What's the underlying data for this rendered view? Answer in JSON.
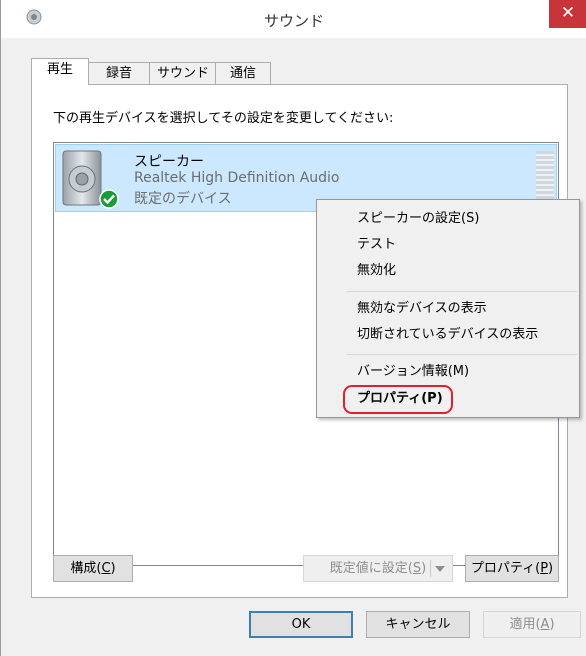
{
  "window": {
    "title": "サウンド",
    "close_glyph": "✕"
  },
  "tabs": [
    {
      "label": "再生",
      "active": true
    },
    {
      "label": "録音",
      "active": false
    },
    {
      "label": "サウンド",
      "active": false
    },
    {
      "label": "通信",
      "active": false
    }
  ],
  "instruction": "下の再生デバイスを選択してその設定を変更してください:",
  "devices": [
    {
      "name": "スピーカー",
      "driver": "Realtek High Definition Audio",
      "status": "既定のデバイス",
      "icon": "speaker-icon",
      "status_icon": "check-icon"
    }
  ],
  "context_menu": {
    "items": [
      {
        "label": "スピーカーの設定(S)"
      },
      {
        "label": "テスト"
      },
      {
        "label": "無効化"
      },
      {
        "label": "無効なデバイスの表示"
      },
      {
        "label": "切断されているデバイスの表示"
      },
      {
        "label": "バージョン情報(M)"
      },
      {
        "label": "プロパティ(P)",
        "highlighted": true
      }
    ]
  },
  "panel_buttons": {
    "configure": {
      "label": "構成(",
      "key": "C",
      "tail": ")"
    },
    "set_default": {
      "label": "既定値に設定(",
      "key": "S",
      "tail": ")"
    },
    "properties": {
      "label": "プロパティ(",
      "key": "P",
      "tail": ")"
    }
  },
  "dialog_buttons": {
    "ok": "OK",
    "cancel": "キャンセル",
    "apply": {
      "label": "適用(",
      "key": "A",
      "tail": ")"
    }
  },
  "colors": {
    "selection_bg": "#cce8ff",
    "close_bg": "#c7343a",
    "highlight_ring": "#e0202a",
    "default_check": "#1a9c3a"
  }
}
